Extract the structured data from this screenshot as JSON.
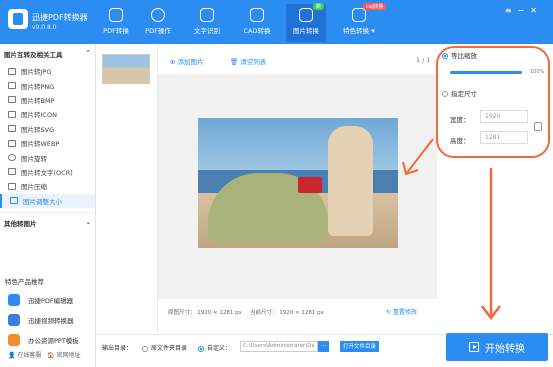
{
  "app": {
    "name": "迅捷PDF转换器",
    "version": "v9.0.8.0"
  },
  "tabs": [
    {
      "label": "PDF转换"
    },
    {
      "label": "PDF操作"
    },
    {
      "label": "文字识别"
    },
    {
      "label": "CAD转换",
      "badge": ""
    },
    {
      "label": "图片转换",
      "badge": "新"
    },
    {
      "label": "特色转换",
      "badge": "caj转换"
    }
  ],
  "sidebar": {
    "section1": "图片互转及相关工具",
    "items": [
      {
        "label": "图片转JPG"
      },
      {
        "label": "图片转PNG"
      },
      {
        "label": "图片转BMP"
      },
      {
        "label": "图片转ICON"
      },
      {
        "label": "图片转SVG"
      },
      {
        "label": "图片转WEBP"
      },
      {
        "label": "图片旋转"
      },
      {
        "label": "图片转文字(OCR)"
      },
      {
        "label": "图片压缩"
      },
      {
        "label": "图片调整大小"
      }
    ],
    "section2": "其他转图片",
    "promo_title": "特色产品推荐",
    "promos": [
      {
        "label": "迅捷PDF编辑器"
      },
      {
        "label": "迅捷视频转换器"
      },
      {
        "label": "办公资源PPT模板"
      }
    ],
    "footer": {
      "service": "在线客服",
      "website": "官网地址"
    }
  },
  "toolbar": {
    "add": "添加图片",
    "clear": "清空列表",
    "page": "1 / 1"
  },
  "info": {
    "original": "原图尺寸： 1920 × 1281 px",
    "current": "当前尺寸： 1920 × 1281 px",
    "reset": "重置修改"
  },
  "settings": {
    "ratio_label": "等比缩放",
    "ratio_value": "100%",
    "ratio_level": 1.0,
    "custom_label": "指定尺寸",
    "width_label": "宽度：",
    "width_value": "1920",
    "height_label": "高度：",
    "height_value": "1281"
  },
  "bottom": {
    "output_label": "输出目录：",
    "opt1": "原文件夹目录",
    "opt2": "自定义：",
    "path": "C:\\Users\\Administrator\\De",
    "dots": "...",
    "open": "打开文件目录",
    "start": "开始转换"
  },
  "colors": {
    "accent": "#2b8cf2",
    "annotation": "#f06a3c"
  }
}
